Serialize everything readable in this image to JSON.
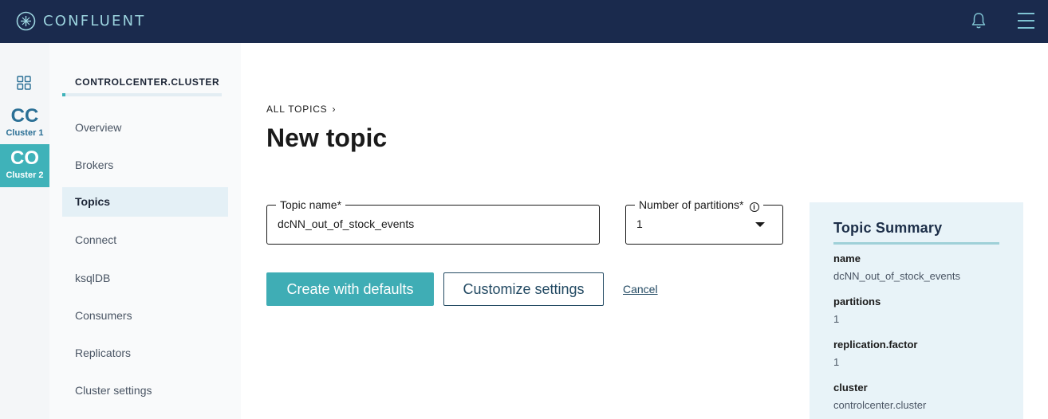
{
  "header": {
    "brand": "CONFLUENT",
    "colors": {
      "background": "#1a2a4d",
      "accent": "#9bd3de"
    }
  },
  "rail": {
    "clusters": [
      {
        "abbr": "CC",
        "label": "Cluster 1"
      },
      {
        "abbr": "CO",
        "label": "Cluster 2",
        "selected": true
      }
    ]
  },
  "sidenav": {
    "cluster_name": "CONTROLCENTER.CLUSTER",
    "items": [
      {
        "label": "Overview"
      },
      {
        "label": "Brokers"
      },
      {
        "label": "Topics",
        "active": true
      },
      {
        "label": "Connect"
      },
      {
        "label": "ksqlDB"
      },
      {
        "label": "Consumers"
      },
      {
        "label": "Replicators"
      },
      {
        "label": "Cluster settings"
      }
    ]
  },
  "main": {
    "breadcrumb": "ALL TOPICS",
    "title": "New topic",
    "topic_name": {
      "label": "Topic name*",
      "value": "dcNN_out_of_stock_events"
    },
    "partitions": {
      "label": "Number of partitions*",
      "value": "1"
    },
    "buttons": {
      "create": "Create with defaults",
      "customize": "Customize settings",
      "cancel": "Cancel"
    }
  },
  "summary": {
    "title": "Topic Summary",
    "fields": [
      {
        "key": "name",
        "value": "dcNN_out_of_stock_events"
      },
      {
        "key": "partitions",
        "value": "1"
      },
      {
        "key": "replication.factor",
        "value": "1"
      },
      {
        "key": "cluster",
        "value": "controlcenter.cluster"
      }
    ]
  }
}
